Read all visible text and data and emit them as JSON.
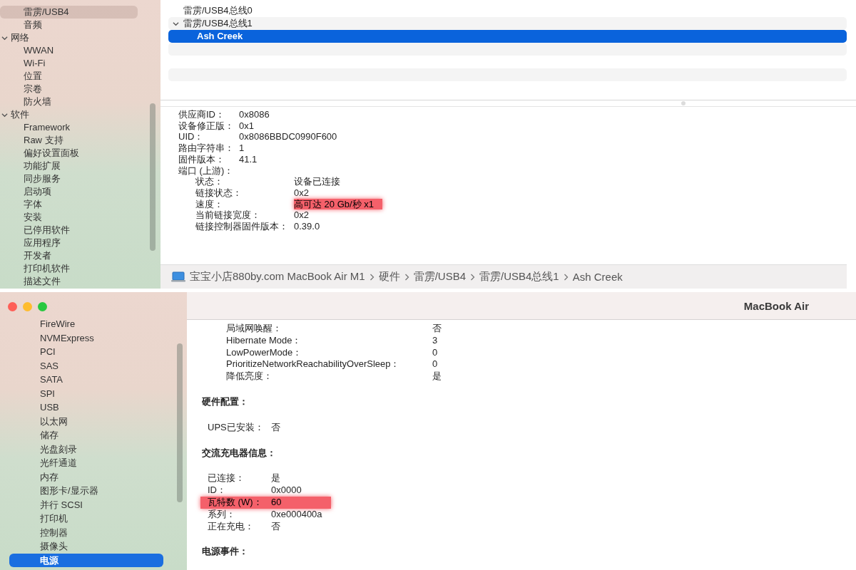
{
  "top_window": {
    "sidebar": {
      "items": [
        {
          "label": "雷雳/USB4",
          "selected": true
        },
        {
          "label": "音频",
          "selected": false
        },
        {
          "label": "网络",
          "expanded": true,
          "children": [
            {
              "label": "WWAN",
              "selected": false
            },
            {
              "label": "Wi-Fi",
              "selected": false
            },
            {
              "label": "位置",
              "selected": false
            },
            {
              "label": "宗卷",
              "selected": false
            },
            {
              "label": "防火墙",
              "selected": false
            }
          ]
        },
        {
          "label": "软件",
          "expanded": true,
          "children": [
            {
              "label": "Framework",
              "selected": false
            },
            {
              "label": "Raw 支持",
              "selected": false
            },
            {
              "label": "偏好设置面板",
              "selected": false
            },
            {
              "label": "功能扩展",
              "selected": false
            },
            {
              "label": "同步服务",
              "selected": false
            },
            {
              "label": "启动项",
              "selected": false
            },
            {
              "label": "字体",
              "selected": false
            },
            {
              "label": "安装",
              "selected": false
            },
            {
              "label": "已停用软件",
              "selected": false
            },
            {
              "label": "应用程序",
              "selected": false
            },
            {
              "label": "开发者",
              "selected": false
            },
            {
              "label": "打印机软件",
              "selected": false
            },
            {
              "label": "描述文件",
              "selected": false
            }
          ]
        }
      ]
    },
    "device_tree": [
      {
        "label": "雷雳/USB4总线0",
        "selected": false
      },
      {
        "label": "雷雳/USB4总线1",
        "selected": false,
        "expanded": true,
        "children": [
          {
            "label": "Ash Creek",
            "selected": true
          }
        ]
      }
    ],
    "details": [
      {
        "label": "供应商ID：",
        "value": "0x8086"
      },
      {
        "label": "设备修正版：",
        "value": "0x1"
      },
      {
        "label": "UID：",
        "value": "0x8086BBDC0990F600"
      },
      {
        "label": "路由字符串：",
        "value": "1"
      },
      {
        "label": "固件版本：",
        "value": "41.1"
      },
      {
        "label": "端口 (上游)：",
        "children": [
          {
            "label": "状态：",
            "value": "设备已连接",
            "highlighted": false
          },
          {
            "label": "链接状态：",
            "value": "0x2",
            "highlighted": false
          },
          {
            "label": "速度：",
            "value": "高可达 20 Gb/秒 x1",
            "highlighted": true
          },
          {
            "label": "当前链接宽度：",
            "value": "0x2",
            "highlighted": false
          },
          {
            "label": "链接控制器固件版本：",
            "value": "0.39.0",
            "highlighted": false
          }
        ]
      }
    ],
    "path_bar": [
      "宝宝小店880by.com MacBook Air M1",
      "硬件",
      "雷雳/USB4",
      "雷雳/USB4总线1",
      "Ash Creek"
    ]
  },
  "bottom_window": {
    "title": "MacBook Air",
    "sidebar": {
      "items": [
        {
          "label": "FireWire",
          "selected": false
        },
        {
          "label": "NVMExpress",
          "selected": false
        },
        {
          "label": "PCI",
          "selected": false
        },
        {
          "label": "SAS",
          "selected": false
        },
        {
          "label": "SATA",
          "selected": false
        },
        {
          "label": "SPI",
          "selected": false
        },
        {
          "label": "USB",
          "selected": false
        },
        {
          "label": "以太网",
          "selected": false
        },
        {
          "label": "储存",
          "selected": false
        },
        {
          "label": "光盘刻录",
          "selected": false
        },
        {
          "label": "光纤通道",
          "selected": false
        },
        {
          "label": "内存",
          "selected": false
        },
        {
          "label": "图形卡/显示器",
          "selected": false
        },
        {
          "label": "并行 SCSI",
          "selected": false
        },
        {
          "label": "打印机",
          "selected": false
        },
        {
          "label": "控制器",
          "selected": false
        },
        {
          "label": "摄像头",
          "selected": false
        },
        {
          "label": "电源",
          "selected": true
        }
      ]
    },
    "sections": [
      {
        "rows": [
          {
            "label": "局域网唤醒：",
            "value": "否",
            "highlighted": false
          },
          {
            "label": "Hibernate Mode：",
            "value": "3",
            "highlighted": false
          },
          {
            "label": "LowPowerMode：",
            "value": "0",
            "highlighted": false
          },
          {
            "label": "PrioritizeNetworkReachabilityOverSleep：",
            "value": "0",
            "highlighted": false
          },
          {
            "label": "降低亮度：",
            "value": "是",
            "highlighted": false
          }
        ]
      },
      {
        "heading": "硬件配置：",
        "rows": [
          {
            "label": "UPS已安装：",
            "value": "否",
            "highlighted": false
          }
        ]
      },
      {
        "heading": "交流充电器信息：",
        "rows": [
          {
            "label": "已连接：",
            "value": "是",
            "highlighted": false
          },
          {
            "label": "ID：",
            "value": "0x0000",
            "highlighted": false
          },
          {
            "label": "瓦特数 (W)：",
            "value": "60",
            "highlighted": true
          },
          {
            "label": "系列：",
            "value": "0xe000400a",
            "highlighted": false
          },
          {
            "label": "正在充电：",
            "value": "否",
            "highlighted": false
          }
        ]
      },
      {
        "heading": "电源事件："
      }
    ]
  }
}
